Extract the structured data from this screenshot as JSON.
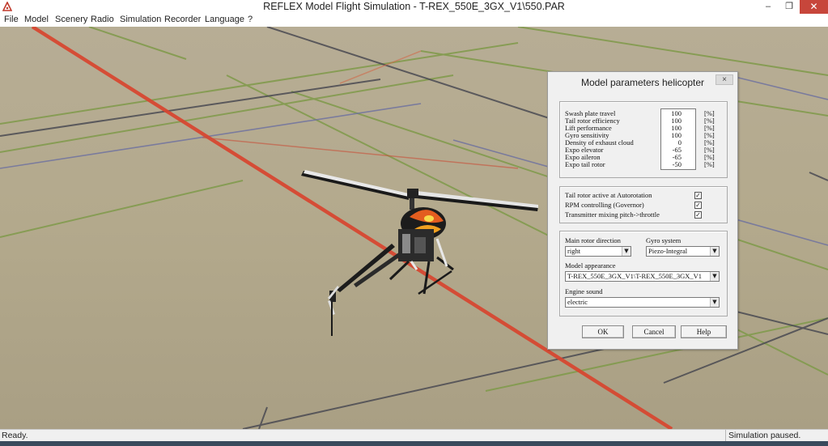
{
  "window": {
    "title": "REFLEX Model Flight Simulation - T-REX_550E_3GX_V1\\550.PAR",
    "icons": [
      "app-logo-icon",
      "minimize-icon",
      "maximize-icon",
      "close-icon"
    ],
    "controls": {
      "minimize": "–",
      "maximize": "❐",
      "close": "✕"
    }
  },
  "menu": {
    "items": [
      "File",
      "Model",
      "Scenery",
      "Radio",
      "Simulation",
      "Recorder",
      "Language",
      "?"
    ]
  },
  "viewport": {
    "floor_color": "#b5ab8f",
    "line_colors": {
      "red": "#d8452f",
      "green": "#7f9a4a",
      "dark": "#4a4a52",
      "purple": "#6b6fa0"
    }
  },
  "dialog": {
    "title": "Model parameters helicopter",
    "close": "×",
    "params": [
      {
        "label": "Swash plate travel",
        "value": "100",
        "unit": "[%]"
      },
      {
        "label": "Tail rotor efficiency",
        "value": "100",
        "unit": "[%]"
      },
      {
        "label": "Lift performance",
        "value": "100",
        "unit": "[%]"
      },
      {
        "label": "Gyro sensitivity",
        "value": "100",
        "unit": "[%]"
      },
      {
        "label": "Density of exhaust cloud",
        "value": "0",
        "unit": "[%]"
      },
      {
        "label": "Expo elevator",
        "value": "-65",
        "unit": "[%]"
      },
      {
        "label": "Expo aileron",
        "value": "-65",
        "unit": "[%]"
      },
      {
        "label": "Expo tail rotor",
        "value": "-50",
        "unit": "[%]"
      }
    ],
    "options": [
      {
        "label": "Tail rotor active at Autorotation",
        "checked": true,
        "mark": "✓"
      },
      {
        "label": "RPM controlling (Governor)",
        "checked": true,
        "mark": "✓"
      },
      {
        "label": "Transmitter mixing pitch->throttle",
        "checked": true,
        "mark": "✓"
      }
    ],
    "rotor_direction": {
      "label": "Main rotor direction",
      "value": "right"
    },
    "gyro_system": {
      "label": "Gyro system",
      "value": "Piezo-Integral"
    },
    "model_appearance": {
      "label": "Model appearance",
      "value": "T-REX_550E_3GX_V1\\T-REX_550E_3GX_V1"
    },
    "engine_sound": {
      "label": "Engine sound",
      "value": "electric"
    },
    "dropdown_arrow": "▼",
    "buttons": {
      "ok": "OK",
      "cancel": "Cancel",
      "help": "Help"
    }
  },
  "status": {
    "left": "Ready.",
    "right": "Simulation paused."
  }
}
